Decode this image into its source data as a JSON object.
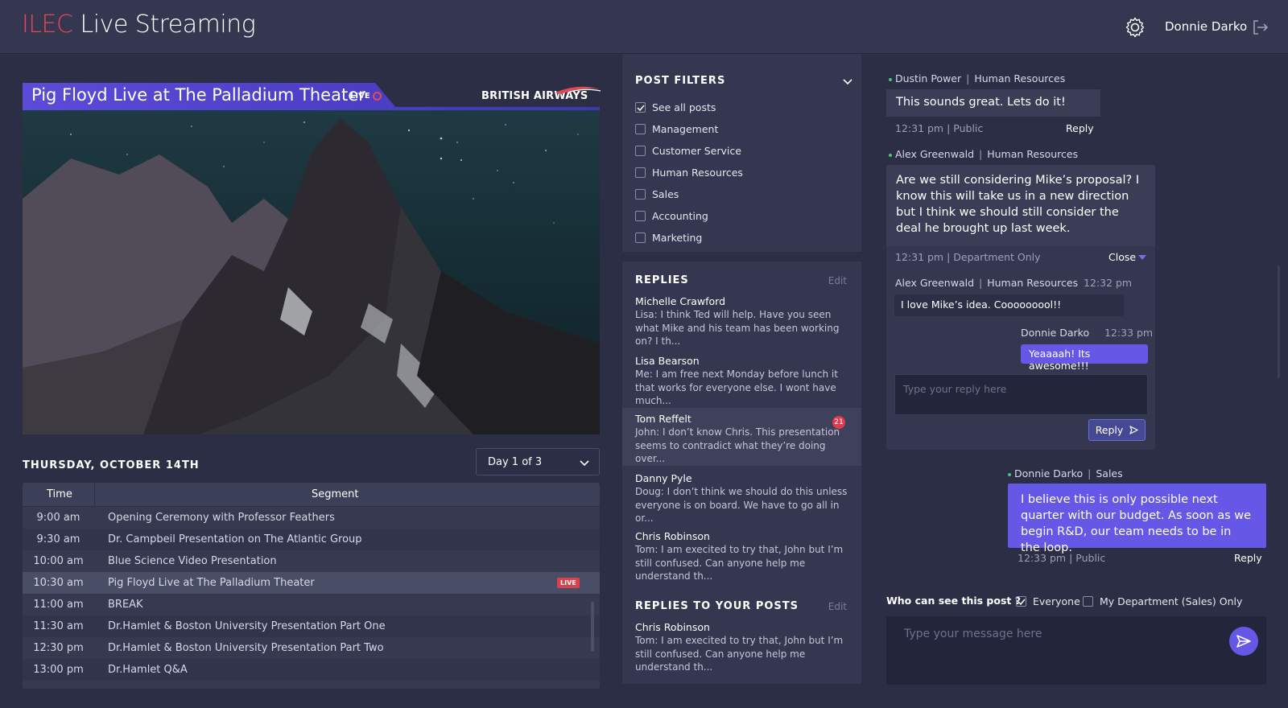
{
  "app": {
    "brand_prefix": "ILEC",
    "brand_suffix": "Live Streaming",
    "user_name": "Donnie Darko",
    "settings_icon": "gear-icon",
    "logout_icon": "logout-icon"
  },
  "video": {
    "title": "Pig Floyd Live at The Palladium Theater",
    "live_label": "LIVE",
    "sponsor": "BRITISH AIRWAYS"
  },
  "schedule": {
    "date_heading": "THURSDAY, OCTOBER 14TH",
    "day_select": "Day 1 of 3",
    "columns": [
      "Time",
      "Segment"
    ],
    "live_badge": "LIVE",
    "rows": [
      {
        "time": "9:00 am",
        "segment": "Opening Ceremony with Professor Feathers"
      },
      {
        "time": "9:30 am",
        "segment": "Dr. Campbeil Presentation on The Atlantic Group"
      },
      {
        "time": "10:00 am",
        "segment": "Blue Science Video Presentation"
      },
      {
        "time": "10:30 am",
        "segment": "Pig Floyd Live at The Palladium Theater"
      },
      {
        "time": "11:00 am",
        "segment": "BREAK"
      },
      {
        "time": "11:30 am",
        "segment": "Dr.Hamlet & Boston University Presentation Part One"
      },
      {
        "time": "12:30 pm",
        "segment": "Dr.Hamlet & Boston University Presentation Part Two"
      },
      {
        "time": "13:00 pm",
        "segment": "Dr.Hamlet Q&A"
      }
    ]
  },
  "filters": {
    "title": "POST FILTERS",
    "items": [
      {
        "label": "See all posts",
        "checked": true
      },
      {
        "label": "Management",
        "checked": false
      },
      {
        "label": "Customer Service",
        "checked": false
      },
      {
        "label": "Human Resources",
        "checked": false
      },
      {
        "label": "Sales",
        "checked": false
      },
      {
        "label": "Accounting",
        "checked": false
      },
      {
        "label": "Marketing",
        "checked": false
      }
    ]
  },
  "replies": {
    "title": "REPLIES",
    "edit": "Edit",
    "items": [
      {
        "name": "Michelle Crawford",
        "text": "Lisa: I think Ted will help. Have you seen what Mike and his team has been working on? I th..."
      },
      {
        "name": "Lisa Bearson",
        "text": "Me: I am free next Monday before lunch it that works for everyone else. I wont have much..."
      },
      {
        "name": "Tom Reffelt",
        "text": "John: I don’t know Chris. This presentation seems to contradict what they’re doing over...",
        "badge": "21"
      },
      {
        "name": "Danny Pyle",
        "text": "Doug: I don’t think we should do this unless everyone is on board. We have to go all in or..."
      },
      {
        "name": "Chris Robinson",
        "text": "Tom: I am execited to try that, John but I’m still confused. Can anyone help me understand th..."
      }
    ]
  },
  "replies_to_posts": {
    "title": "REPLIES TO YOUR POSTS",
    "edit": "Edit",
    "items": [
      {
        "name": "Chris Robinson",
        "text": "Tom: I am execited to try that, John but I’m still confused. Can anyone help me understand th..."
      }
    ]
  },
  "chat": {
    "msg1": {
      "author": "Dustin Power",
      "dept": "Human Resources",
      "text": "This sounds great. Lets do it!",
      "footer": "12:31 pm | Public",
      "reply": "Reply"
    },
    "msg2": {
      "author": "Alex Greenwald",
      "dept": "Human Resources",
      "text": "Are we still considering Mike’s proposal? I know this will take us in a new direction but I think we should still consider the deal he brought up last week.",
      "footer": "12:31 pm | Department Only",
      "close": "Close"
    },
    "thread": {
      "r1_author": "Alex Greenwald",
      "r1_dept": "Human Resources",
      "r1_time": "12:32 pm",
      "r1_text": "I love Mike’s idea. Cooooooool!!",
      "r2_author": "Donnie Darko",
      "r2_time": "12:33 pm",
      "r2_text": "Yeaaaah! Its awesome!!!",
      "placeholder": "Type your reply here",
      "reply_button": "Reply"
    },
    "msg3": {
      "author": "Donnie Darko",
      "dept": "Sales",
      "text": "I believe this is only possible next quarter with our budget. As soon as we begin R&D, our team needs to be in the loop.",
      "footer": "12:33 pm | Public",
      "reply": "Reply"
    }
  },
  "compose": {
    "visibility_label": "Who can see this post ?",
    "options": [
      {
        "label": "Everyone",
        "checked": true
      },
      {
        "label": "My Department (Sales) Only",
        "checked": false
      }
    ],
    "placeholder": "Type your message here",
    "send_icon": "send-icon"
  },
  "colors": {
    "accent": "#6658e6",
    "brand_red": "#e24a52",
    "background": "#2b2e45",
    "panel": "#34374f"
  }
}
